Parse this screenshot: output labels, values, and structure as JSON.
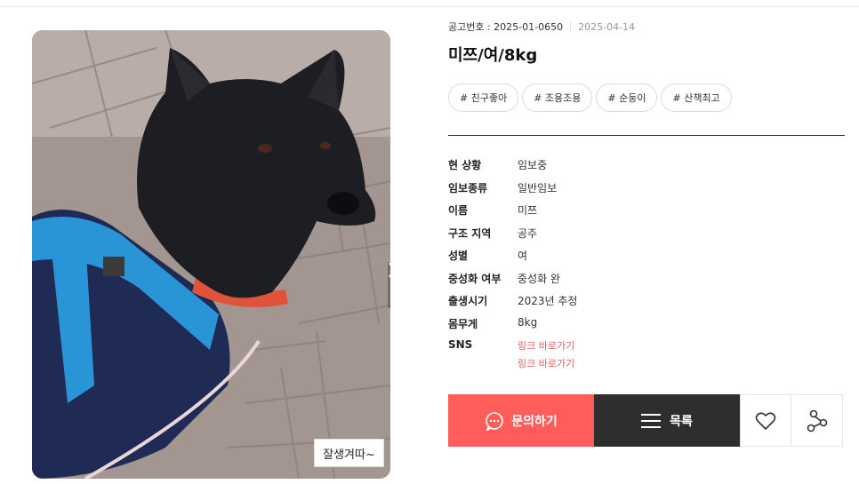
{
  "notice": {
    "number": "공고번호 : 2025-01-0650",
    "date": "2025-04-14"
  },
  "title": "미쯔/여/8kg",
  "tags": [
    "# 친구좋아",
    "# 조용조용",
    "# 순둥이",
    "# 산책최고"
  ],
  "details": [
    {
      "label": "현 상황",
      "value": "임보중"
    },
    {
      "label": "임보종류",
      "value": "일반임보"
    },
    {
      "label": "이름",
      "value": "미쯔"
    },
    {
      "label": "구조 지역",
      "value": "공주"
    },
    {
      "label": "성별",
      "value": "여"
    },
    {
      "label": "중성화 여부",
      "value": "중성화 완"
    },
    {
      "label": "출생시기",
      "value": "2023년 추정"
    },
    {
      "label": "몸무게",
      "value": "8kg"
    }
  ],
  "sns": {
    "label": "SNS",
    "links": [
      "링크 바로가기",
      "링크 바로가기"
    ]
  },
  "photo": {
    "caption": "잘생겨따~"
  },
  "actions": {
    "inquiry_label": "문의하기",
    "list_label": "목록"
  },
  "colors": {
    "accent": "#ff5c5c",
    "dark": "#2e2e2e",
    "link": "#e85c5c"
  },
  "icons": {
    "next": "chevron-right-icon",
    "inquiry": "chat-bubble-icon",
    "list": "menu-icon",
    "like": "heart-icon",
    "share": "share-icon"
  }
}
